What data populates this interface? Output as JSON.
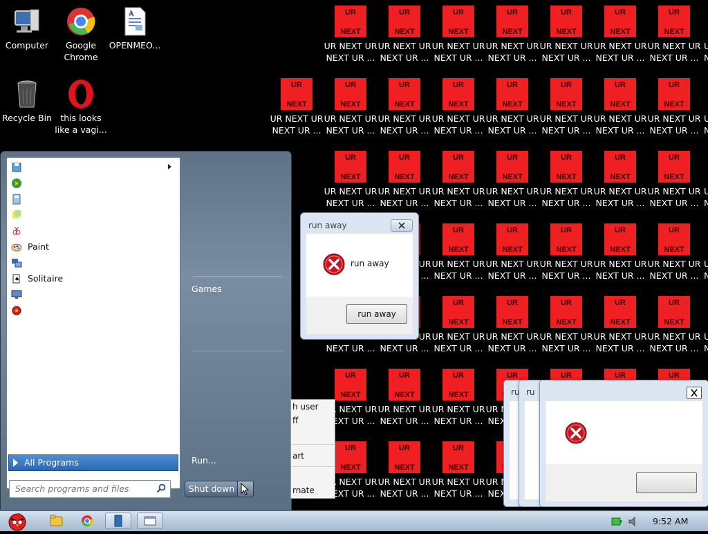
{
  "desktop": {
    "icons": [
      {
        "label": "Computer",
        "icon": "computer-icon"
      },
      {
        "label": "Google\nChrome",
        "icon": "chrome-icon"
      },
      {
        "label": "OPENMEO...",
        "icon": "document-icon"
      },
      {
        "label": "Recycle Bin",
        "icon": "recycle-bin-icon"
      },
      {
        "label": "this looks\nlike a vagi...",
        "icon": "opera-icon"
      }
    ],
    "ur_tile": {
      "top_text": "UR",
      "bottom_text": "NEXT",
      "label": "UR NEXT UR\nNEXT UR ..."
    },
    "colors": {
      "tile_red": "#ef1f22",
      "background": "#000000"
    }
  },
  "start_menu": {
    "programs": [
      {
        "label": "",
        "icon": "disk-icon",
        "has_submenu": true
      },
      {
        "label": "",
        "icon": "media-center-icon",
        "has_submenu": false
      },
      {
        "label": "",
        "icon": "calculator-icon",
        "has_submenu": false
      },
      {
        "label": "",
        "icon": "sticky-notes-icon",
        "has_submenu": false
      },
      {
        "label": "",
        "icon": "snipping-tool-icon",
        "has_submenu": false
      },
      {
        "label": "Paint",
        "icon": "paint-icon",
        "has_submenu": false
      },
      {
        "label": "",
        "icon": "remote-desktop-icon",
        "has_submenu": false
      },
      {
        "label": "Solitaire",
        "icon": "solitaire-icon",
        "has_submenu": false
      },
      {
        "label": "",
        "icon": "display-icon",
        "has_submenu": false
      },
      {
        "label": "",
        "icon": "red-app-icon",
        "has_submenu": false
      }
    ],
    "all_programs": "All Programs",
    "search_placeholder": "Search programs and files",
    "right_items": {
      "games": "Games",
      "run": "Run..."
    },
    "shutdown_label": "Shut down"
  },
  "shutdown_submenu": {
    "items": [
      "h user",
      "ff",
      "",
      "art",
      "",
      "rnate"
    ]
  },
  "dialog_main": {
    "title": "run away",
    "message": "run away",
    "button": "run away"
  },
  "dialog_stack": {
    "title_fragments": [
      "ru",
      "ru"
    ],
    "button": ""
  },
  "taskbar": {
    "time": "9:52 AM"
  }
}
